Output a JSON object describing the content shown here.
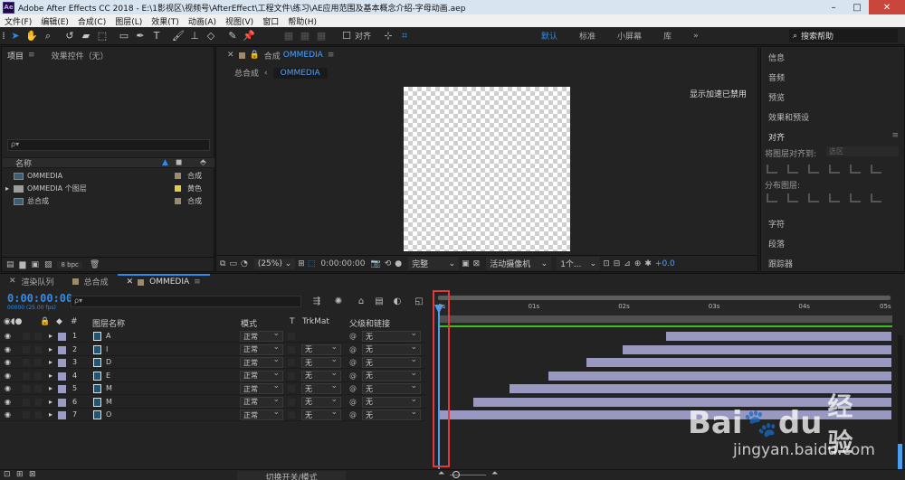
{
  "window": {
    "title": "Adobe After Effects CC 2018 - E:\\1影视区\\视频号\\AfterEffect\\工程文件\\练习\\AE应用范围及基本概念介绍-字母动画.aep",
    "logo": "Ae",
    "minimize": "–",
    "maximize": "□",
    "close": "✕"
  },
  "menu": [
    "文件(F)",
    "编辑(E)",
    "合成(C)",
    "图层(L)",
    "效果(T)",
    "动画(A)",
    "视图(V)",
    "窗口",
    "帮助(H)"
  ],
  "toolbar": {
    "snap_label": "对齐",
    "workspaces": [
      "默认",
      "标准",
      "小屏幕",
      "库"
    ],
    "more": "»",
    "help_search_placeholder": "搜索帮助"
  },
  "project_panel": {
    "tab_project": "项目",
    "tab_effects": "效果控件（无）",
    "search_placeholder": "ρ▾",
    "col_name": "名称",
    "items": [
      {
        "name": "OMMEDIA",
        "type": "合成",
        "color": "#9b8a6b",
        "kind": "comp"
      },
      {
        "name": "OMMEDIA 个图层",
        "type": "黄色",
        "color": "#e2cf3c",
        "kind": "folder"
      },
      {
        "name": "总合成",
        "type": "合成",
        "color": "#9b8a6b",
        "kind": "comp"
      }
    ],
    "bpc": "8 bpc"
  },
  "viewer": {
    "comp_label": "合成",
    "comp_name": "OMMEDIA",
    "breadcrumb_parent": "总合成",
    "breadcrumb_current": "OMMEDIA",
    "gpu_note": "显示加速已禁用",
    "zoom": "(25%)",
    "time": "0:00:00:00",
    "resolution": "完整",
    "camera": "活动摄像机",
    "views": "1个...",
    "exposure": "+0.0"
  },
  "right_panel": {
    "items": [
      "信息",
      "音频",
      "预览",
      "效果和预设",
      "对齐"
    ],
    "align_layers_to": "将图层对齐到:",
    "align_target": "选区",
    "distribute": "分布图层:",
    "lower_items": [
      "字符",
      "段落",
      "跟踪器"
    ]
  },
  "timeline": {
    "tabs": [
      "渲染队列",
      "总合成",
      "OMMEDIA"
    ],
    "timecode": "0:00:00:00",
    "timecode_sub": "00000 (25.00 fps)",
    "search_placeholder": "ρ▾",
    "headers": {
      "num": "#",
      "layer_name": "图层名称",
      "mode": "模式",
      "t": "T",
      "trkmat": "TrkMat",
      "parent": "父级和链接"
    },
    "ticks": [
      "0s",
      "01s",
      "02s",
      "03s",
      "04s",
      "05s"
    ],
    "layers": [
      {
        "num": "1",
        "name": "A",
        "mode": "正常",
        "trkmat": "",
        "parent": "无",
        "start": 0.5
      },
      {
        "num": "2",
        "name": "I",
        "mode": "正常",
        "trkmat": "无",
        "parent": "无",
        "start": 0.405
      },
      {
        "num": "3",
        "name": "D",
        "mode": "正常",
        "trkmat": "无",
        "parent": "无",
        "start": 0.325
      },
      {
        "num": "4",
        "name": "E",
        "mode": "正常",
        "trkmat": "无",
        "parent": "无",
        "start": 0.24
      },
      {
        "num": "5",
        "name": "M",
        "mode": "正常",
        "trkmat": "无",
        "parent": "无",
        "start": 0.155
      },
      {
        "num": "6",
        "name": "M",
        "mode": "正常",
        "trkmat": "无",
        "parent": "无",
        "start": 0.075
      },
      {
        "num": "7",
        "name": "O",
        "mode": "正常",
        "trkmat": "无",
        "parent": "无",
        "start": 0.0
      }
    ],
    "toggle_mode": "切换开关/模式"
  },
  "watermark": {
    "logo_a": "Bai",
    "logo_b": "du",
    "logo_c": "经验",
    "url": "jingyan.baidu.com"
  }
}
